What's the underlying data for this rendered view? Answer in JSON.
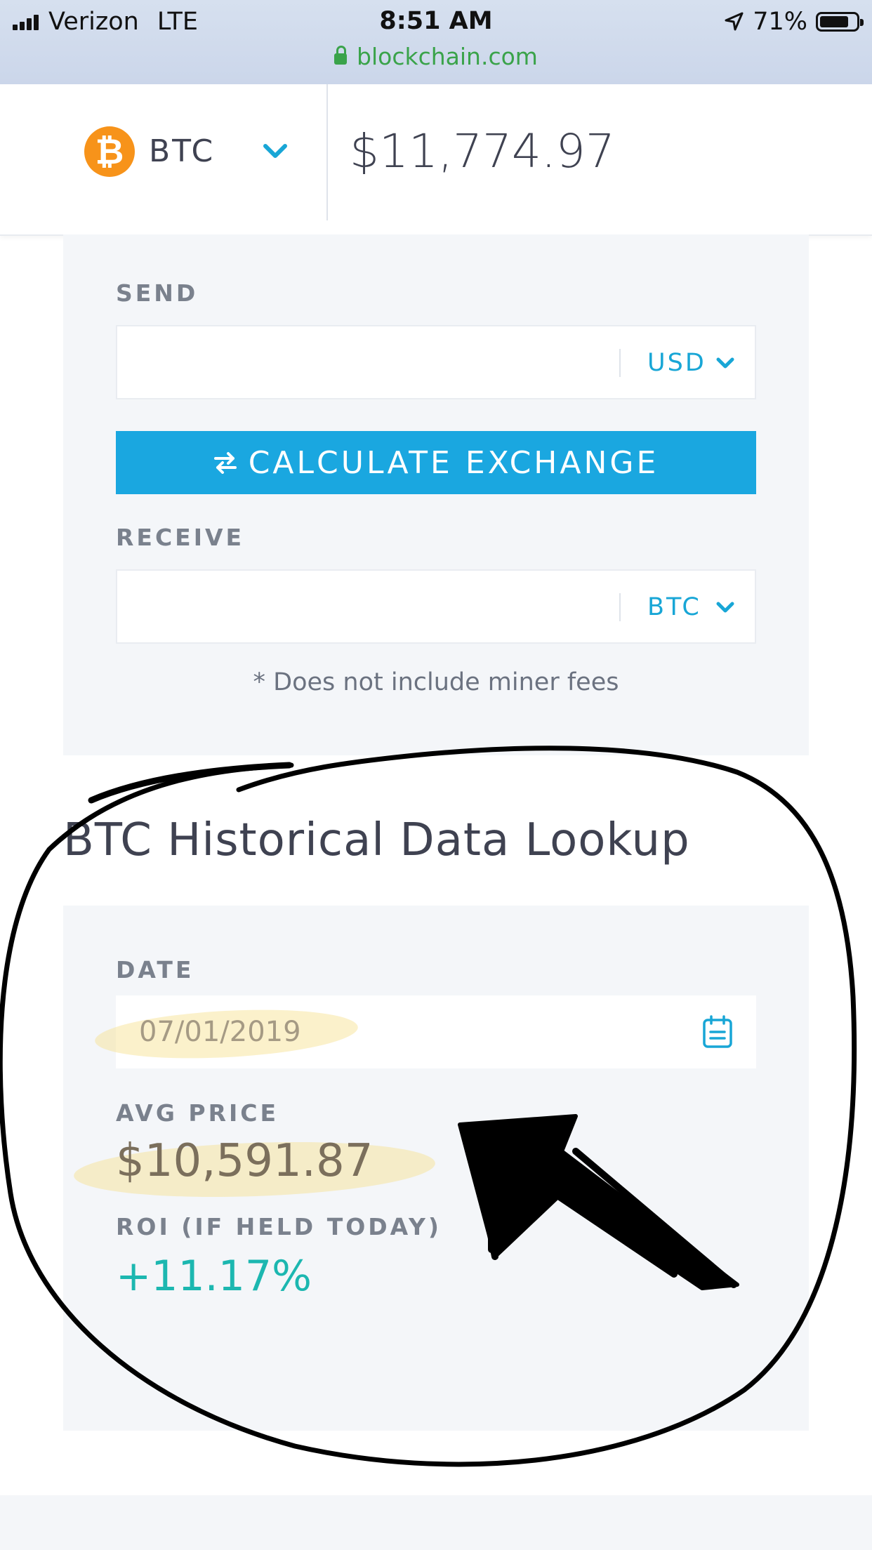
{
  "status_bar": {
    "carrier": "Verizon",
    "network": "LTE",
    "time": "8:51 AM",
    "battery": "71%"
  },
  "browser": {
    "url": "blockchain.com"
  },
  "header": {
    "coin_symbol_glyph": "₿",
    "coin": "BTC",
    "price": "$11,774.97"
  },
  "exchange": {
    "send_label": "SEND",
    "send_currency": "USD",
    "button_label": "CALCULATE EXCHANGE",
    "receive_label": "RECEIVE",
    "receive_currency": "BTC",
    "note": "* Does not include miner fees"
  },
  "historical": {
    "title": "BTC Historical Data Lookup",
    "date_label": "DATE",
    "date_value": "07/01/2019",
    "avg_price_label": "AVG PRICE",
    "avg_price": "$10,591.87",
    "roi_label": "ROI (IF HELD TODAY)",
    "roi": "+11.17%"
  },
  "colors": {
    "accent": "#1aa7e0",
    "bitcoin_orange": "#f7931a",
    "roi_green": "#1cb7b0",
    "url_green": "#3aa34a",
    "highlighter": "#f7e08c",
    "pen_ink": "#000000"
  },
  "icons": [
    "signal-bars-icon",
    "location-arrow-icon",
    "battery-icon",
    "lock-icon",
    "bitcoin-icon",
    "chevron-down-icon",
    "swap-arrows-icon",
    "calendar-icon"
  ]
}
